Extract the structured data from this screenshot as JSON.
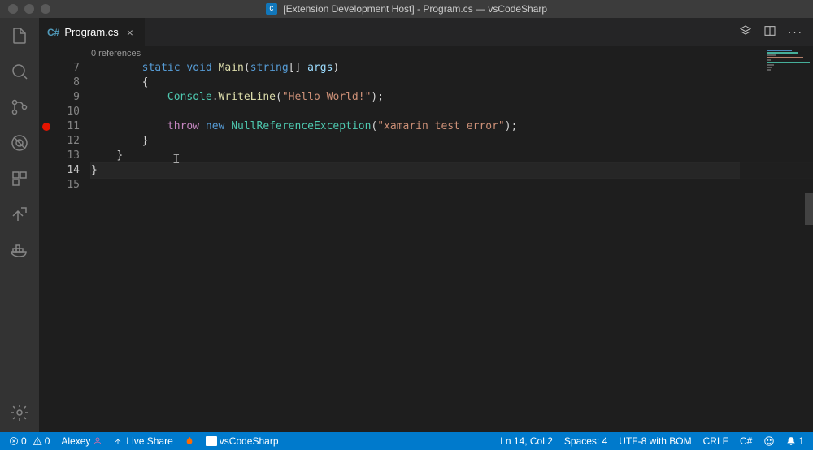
{
  "titlebar": {
    "title": "[Extension Development Host] - Program.cs — vsCodeSharp"
  },
  "tab": {
    "filename": "Program.cs",
    "icon_label": "C#"
  },
  "codelens": {
    "references": "0 references"
  },
  "code": {
    "lines": [
      7,
      8,
      9,
      10,
      11,
      12,
      13,
      14,
      15
    ],
    "breakpoint_line": 11,
    "current_line": 14
  },
  "tokens": {
    "static": "static",
    "void": "void",
    "Main": "Main",
    "string": "string",
    "args": "args",
    "Console": "Console",
    "WriteLine": "WriteLine",
    "hello": "\"Hello World!\"",
    "throw": "throw",
    "new": "new",
    "NullRef": "NullReferenceException",
    "xamarin": "\"xamarin test error\""
  },
  "status": {
    "errors": "0",
    "warnings": "0",
    "user": "Alexey",
    "liveshare": "Live Share",
    "flame": "",
    "folder": "vsCodeSharp",
    "lncol": "Ln 14, Col 2",
    "spaces": "Spaces: 4",
    "encoding": "UTF-8 with BOM",
    "eol": "CRLF",
    "lang": "C#",
    "bell": "1"
  }
}
